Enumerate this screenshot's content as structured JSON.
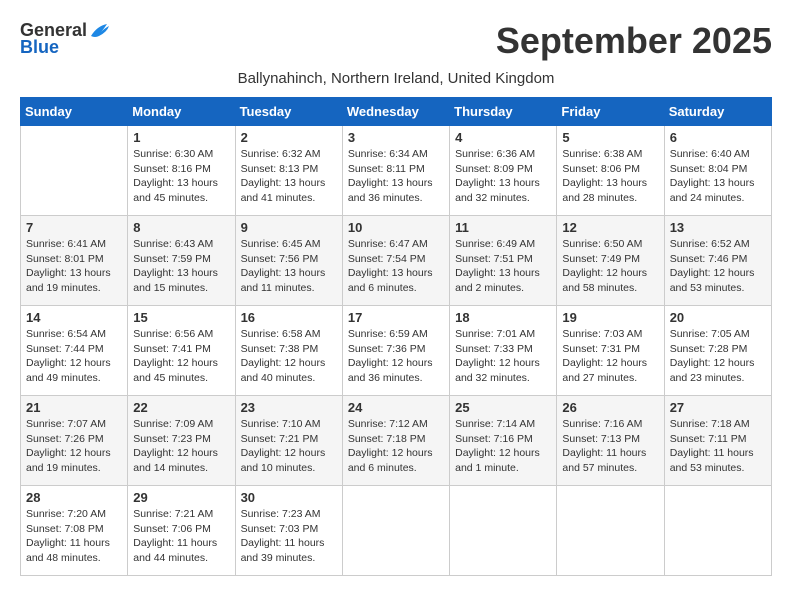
{
  "header": {
    "logo_general": "General",
    "logo_blue": "Blue",
    "month_year": "September 2025",
    "location": "Ballynahinch, Northern Ireland, United Kingdom"
  },
  "days_of_week": [
    "Sunday",
    "Monday",
    "Tuesday",
    "Wednesday",
    "Thursday",
    "Friday",
    "Saturday"
  ],
  "weeks": [
    [
      {
        "day": "",
        "content": ""
      },
      {
        "day": "1",
        "content": "Sunrise: 6:30 AM\nSunset: 8:16 PM\nDaylight: 13 hours\nand 45 minutes."
      },
      {
        "day": "2",
        "content": "Sunrise: 6:32 AM\nSunset: 8:13 PM\nDaylight: 13 hours\nand 41 minutes."
      },
      {
        "day": "3",
        "content": "Sunrise: 6:34 AM\nSunset: 8:11 PM\nDaylight: 13 hours\nand 36 minutes."
      },
      {
        "day": "4",
        "content": "Sunrise: 6:36 AM\nSunset: 8:09 PM\nDaylight: 13 hours\nand 32 minutes."
      },
      {
        "day": "5",
        "content": "Sunrise: 6:38 AM\nSunset: 8:06 PM\nDaylight: 13 hours\nand 28 minutes."
      },
      {
        "day": "6",
        "content": "Sunrise: 6:40 AM\nSunset: 8:04 PM\nDaylight: 13 hours\nand 24 minutes."
      }
    ],
    [
      {
        "day": "7",
        "content": "Sunrise: 6:41 AM\nSunset: 8:01 PM\nDaylight: 13 hours\nand 19 minutes."
      },
      {
        "day": "8",
        "content": "Sunrise: 6:43 AM\nSunset: 7:59 PM\nDaylight: 13 hours\nand 15 minutes."
      },
      {
        "day": "9",
        "content": "Sunrise: 6:45 AM\nSunset: 7:56 PM\nDaylight: 13 hours\nand 11 minutes."
      },
      {
        "day": "10",
        "content": "Sunrise: 6:47 AM\nSunset: 7:54 PM\nDaylight: 13 hours\nand 6 minutes."
      },
      {
        "day": "11",
        "content": "Sunrise: 6:49 AM\nSunset: 7:51 PM\nDaylight: 13 hours\nand 2 minutes."
      },
      {
        "day": "12",
        "content": "Sunrise: 6:50 AM\nSunset: 7:49 PM\nDaylight: 12 hours\nand 58 minutes."
      },
      {
        "day": "13",
        "content": "Sunrise: 6:52 AM\nSunset: 7:46 PM\nDaylight: 12 hours\nand 53 minutes."
      }
    ],
    [
      {
        "day": "14",
        "content": "Sunrise: 6:54 AM\nSunset: 7:44 PM\nDaylight: 12 hours\nand 49 minutes."
      },
      {
        "day": "15",
        "content": "Sunrise: 6:56 AM\nSunset: 7:41 PM\nDaylight: 12 hours\nand 45 minutes."
      },
      {
        "day": "16",
        "content": "Sunrise: 6:58 AM\nSunset: 7:38 PM\nDaylight: 12 hours\nand 40 minutes."
      },
      {
        "day": "17",
        "content": "Sunrise: 6:59 AM\nSunset: 7:36 PM\nDaylight: 12 hours\nand 36 minutes."
      },
      {
        "day": "18",
        "content": "Sunrise: 7:01 AM\nSunset: 7:33 PM\nDaylight: 12 hours\nand 32 minutes."
      },
      {
        "day": "19",
        "content": "Sunrise: 7:03 AM\nSunset: 7:31 PM\nDaylight: 12 hours\nand 27 minutes."
      },
      {
        "day": "20",
        "content": "Sunrise: 7:05 AM\nSunset: 7:28 PM\nDaylight: 12 hours\nand 23 minutes."
      }
    ],
    [
      {
        "day": "21",
        "content": "Sunrise: 7:07 AM\nSunset: 7:26 PM\nDaylight: 12 hours\nand 19 minutes."
      },
      {
        "day": "22",
        "content": "Sunrise: 7:09 AM\nSunset: 7:23 PM\nDaylight: 12 hours\nand 14 minutes."
      },
      {
        "day": "23",
        "content": "Sunrise: 7:10 AM\nSunset: 7:21 PM\nDaylight: 12 hours\nand 10 minutes."
      },
      {
        "day": "24",
        "content": "Sunrise: 7:12 AM\nSunset: 7:18 PM\nDaylight: 12 hours\nand 6 minutes."
      },
      {
        "day": "25",
        "content": "Sunrise: 7:14 AM\nSunset: 7:16 PM\nDaylight: 12 hours\nand 1 minute."
      },
      {
        "day": "26",
        "content": "Sunrise: 7:16 AM\nSunset: 7:13 PM\nDaylight: 11 hours\nand 57 minutes."
      },
      {
        "day": "27",
        "content": "Sunrise: 7:18 AM\nSunset: 7:11 PM\nDaylight: 11 hours\nand 53 minutes."
      }
    ],
    [
      {
        "day": "28",
        "content": "Sunrise: 7:20 AM\nSunset: 7:08 PM\nDaylight: 11 hours\nand 48 minutes."
      },
      {
        "day": "29",
        "content": "Sunrise: 7:21 AM\nSunset: 7:06 PM\nDaylight: 11 hours\nand 44 minutes."
      },
      {
        "day": "30",
        "content": "Sunrise: 7:23 AM\nSunset: 7:03 PM\nDaylight: 11 hours\nand 39 minutes."
      },
      {
        "day": "",
        "content": ""
      },
      {
        "day": "",
        "content": ""
      },
      {
        "day": "",
        "content": ""
      },
      {
        "day": "",
        "content": ""
      }
    ]
  ]
}
